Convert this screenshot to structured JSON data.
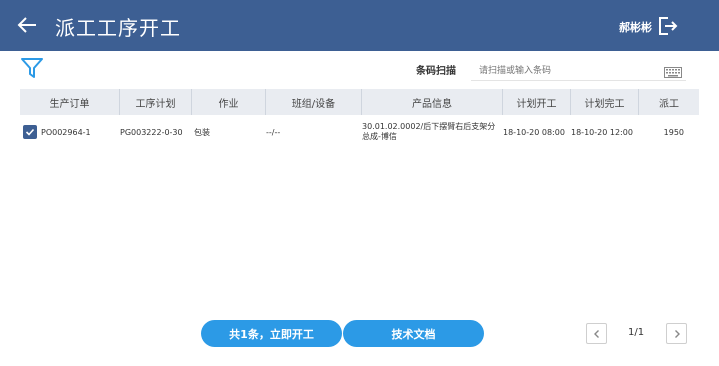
{
  "header": {
    "title": "派工工序开工",
    "user": "郝彬彬"
  },
  "scan": {
    "label": "条码扫描",
    "placeholder": "请扫描或输入条码"
  },
  "table": {
    "columns": [
      "生产订单",
      "工序计划",
      "作业",
      "班组/设备",
      "产品信息",
      "计划开工",
      "计划完工",
      "派工"
    ],
    "rows": [
      {
        "checked": true,
        "order": "PO002964-1",
        "plan": "PG003222-0-30",
        "job": "包装",
        "team": "--/--",
        "product": "30.01.02.0002/后下摆臂右后支架分总成-博信",
        "start": "18-10-20 08:00",
        "end": "18-10-20 12:00",
        "qty": "1950"
      }
    ]
  },
  "footer": {
    "start_button": "共1条，立即开工",
    "docs_button": "技术文档",
    "page": "1/1"
  },
  "colors": {
    "header": "#3d5f93",
    "accent": "#2c9ae6"
  }
}
